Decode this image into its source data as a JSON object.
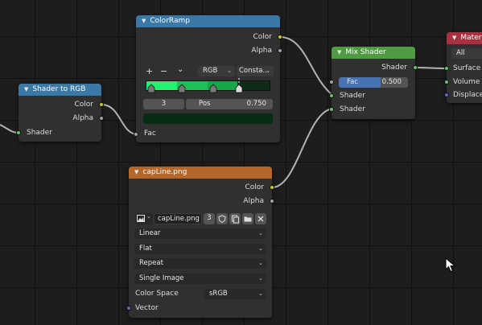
{
  "nodes": {
    "shader_to_rgb": {
      "title": "Shader to RGB",
      "outputs": [
        "Color",
        "Alpha"
      ],
      "inputs": [
        "Shader"
      ]
    },
    "color_ramp": {
      "title": "ColorRamp",
      "outputs": [
        "Color",
        "Alpha"
      ],
      "tool_add": "+",
      "tool_remove": "−",
      "tool_menu": "⌄",
      "color_mode": "RGB",
      "interpolation": "Consta...",
      "stop_index": "3",
      "pos_label": "Pos",
      "pos_value": "0.750",
      "ramp_colors": [
        "#22f26f",
        "#1fbf58",
        "#18a646",
        "#0f2b1a"
      ],
      "swatch_color": "#062c14",
      "input": "Fac"
    },
    "mix_shader": {
      "title": "Mix Shader",
      "output": "Shader",
      "fac_label": "Fac",
      "fac_value": "0.500",
      "inputs": [
        "Shader",
        "Shader"
      ]
    },
    "material_output": {
      "title": "Materia",
      "target": "All",
      "inputs": [
        "Surface",
        "Volume",
        "Displacer"
      ]
    },
    "image": {
      "title": "capLine.png",
      "outputs": [
        "Color",
        "Alpha"
      ],
      "image_name": "capLine.png",
      "users": "3",
      "interpolation": "Linear",
      "projection": "Flat",
      "extension": "Repeat",
      "source": "Single Image",
      "color_space_label": "Color Space",
      "color_space": "sRGB",
      "input": "Vector"
    }
  },
  "colors": {
    "wire": "#b0b0b0",
    "socket_color": "#c7c729",
    "socket_shader": "#63c763",
    "socket_vector": "#6363c7"
  }
}
